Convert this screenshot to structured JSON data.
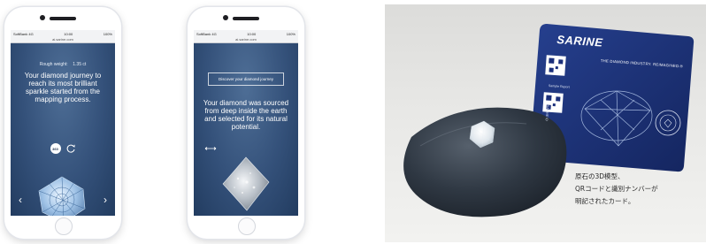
{
  "phone1": {
    "status": {
      "carrier": "SoftBank",
      "network": "4G",
      "time": "10:00",
      "battery": "100%"
    },
    "url": "ai.sarine.com",
    "rough_weight_label": "Rough weight:",
    "rough_weight_value": "1.35 ct",
    "journey_text": "Your diamond journey to reach its most brilliant sparkle started from the mapping process.",
    "icon_360_label": "360",
    "prev_arrow": "‹",
    "next_arrow": "›"
  },
  "phone2": {
    "status": {
      "carrier": "SoftBank",
      "network": "4G",
      "time": "10:00",
      "battery": "100%"
    },
    "url": "ai.sarine.com",
    "cta_label": "Discover your diamond journey",
    "source_text": "Your diamond was sourced from deep inside the earth and selected for its natural potential."
  },
  "photo": {
    "card_brand": "SARINE",
    "card_tagline": "THE DIAMOND INDUSTRY. REIMAGINED.®",
    "card_sample_text": "Sample Report",
    "card_number_text": "SARINE ID",
    "caption_lines": [
      "原石の3D模型、",
      "QRコードと識別ナンバーが",
      "明記されたカード。"
    ]
  },
  "colors": {
    "screen_blue": "#34517a",
    "card_blue": "#1b2f7a",
    "pillow": "#2c3440"
  }
}
